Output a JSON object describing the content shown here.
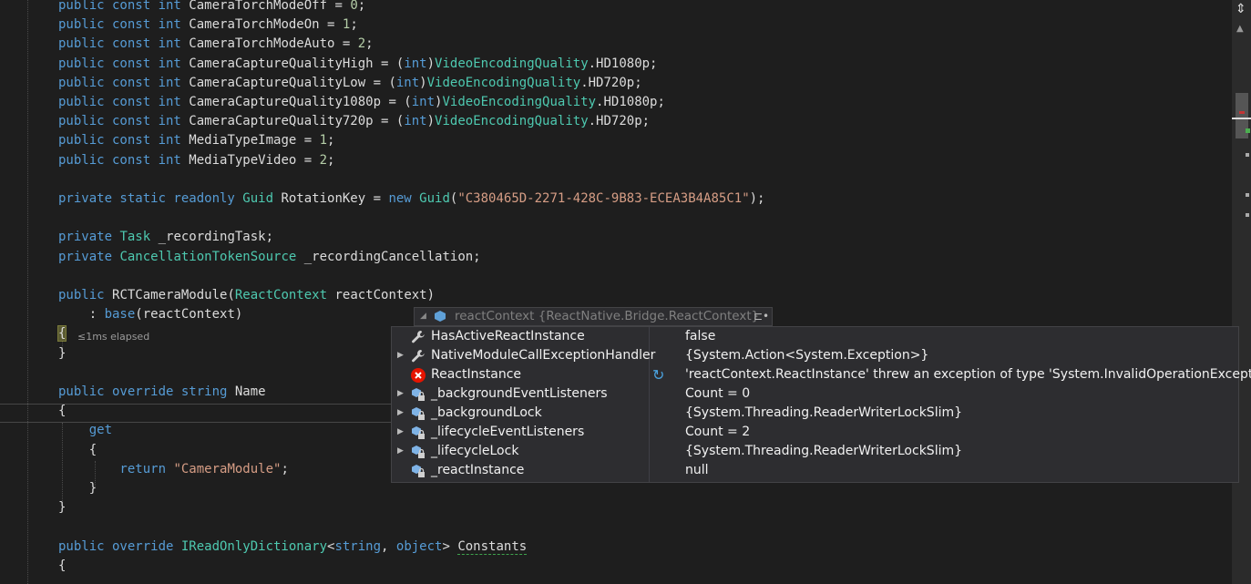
{
  "editor": {
    "lines": [
      [
        [
          "kw",
          "public const int "
        ],
        [
          "",
          "CameraTorchModeOff = "
        ],
        [
          "num",
          "0"
        ],
        [
          "",
          ";"
        ]
      ],
      [
        [
          "kw",
          "public const int "
        ],
        [
          "",
          "CameraTorchModeOn = "
        ],
        [
          "num",
          "1"
        ],
        [
          "",
          ";"
        ]
      ],
      [
        [
          "kw",
          "public const int "
        ],
        [
          "",
          "CameraTorchModeAuto = "
        ],
        [
          "num",
          "2"
        ],
        [
          "",
          ";"
        ]
      ],
      [
        [
          "kw",
          "public const int "
        ],
        [
          "",
          "CameraCaptureQualityHigh = ("
        ],
        [
          "kw",
          "int"
        ],
        [
          "",
          ")"
        ],
        [
          "ty",
          "VideoEncodingQuality"
        ],
        [
          "",
          ".HD1080p;"
        ]
      ],
      [
        [
          "kw",
          "public const int "
        ],
        [
          "",
          "CameraCaptureQualityLow = ("
        ],
        [
          "kw",
          "int"
        ],
        [
          "",
          ")"
        ],
        [
          "ty",
          "VideoEncodingQuality"
        ],
        [
          "",
          ".HD720p;"
        ]
      ],
      [
        [
          "kw",
          "public const int "
        ],
        [
          "",
          "CameraCaptureQuality1080p = ("
        ],
        [
          "kw",
          "int"
        ],
        [
          "",
          ")"
        ],
        [
          "ty",
          "VideoEncodingQuality"
        ],
        [
          "",
          ".HD1080p;"
        ]
      ],
      [
        [
          "kw",
          "public const int "
        ],
        [
          "",
          "CameraCaptureQuality720p = ("
        ],
        [
          "kw",
          "int"
        ],
        [
          "",
          ")"
        ],
        [
          "ty",
          "VideoEncodingQuality"
        ],
        [
          "",
          ".HD720p;"
        ]
      ],
      [
        [
          "kw",
          "public const int "
        ],
        [
          "",
          "MediaTypeImage = "
        ],
        [
          "num",
          "1"
        ],
        [
          "",
          ";"
        ]
      ],
      [
        [
          "kw",
          "public const int "
        ],
        [
          "",
          "MediaTypeVideo = "
        ],
        [
          "num",
          "2"
        ],
        [
          "",
          ";"
        ]
      ],
      [],
      [
        [
          "kw",
          "private static readonly "
        ],
        [
          "ty",
          "Guid"
        ],
        [
          "",
          " RotationKey = "
        ],
        [
          "kw",
          "new "
        ],
        [
          "ty",
          "Guid"
        ],
        [
          "",
          "("
        ],
        [
          "st",
          "\"C380465D-2271-428C-9B83-ECEA3B4A85C1\""
        ],
        [
          "",
          ");"
        ]
      ],
      [],
      [
        [
          "kw",
          "private "
        ],
        [
          "ty",
          "Task"
        ],
        [
          "",
          " _recordingTask;"
        ]
      ],
      [
        [
          "kw",
          "private "
        ],
        [
          "ty",
          "CancellationTokenSource"
        ],
        [
          "",
          " _recordingCancellation;"
        ]
      ],
      [],
      [
        [
          "kw",
          "public "
        ],
        [
          "",
          "RCTCameraModule("
        ],
        [
          "ty",
          "ReactContext"
        ],
        [
          "",
          " reactContext)"
        ]
      ],
      [
        [
          "",
          "    : "
        ],
        [
          "kw",
          "base"
        ],
        [
          "",
          "(reactContext)"
        ]
      ],
      [
        [
          "brace",
          "{"
        ]
      ],
      [
        [
          "",
          "}"
        ]
      ],
      [],
      [
        [
          "kw",
          "public override string "
        ],
        [
          "",
          "Name"
        ]
      ],
      [
        [
          "",
          "{"
        ]
      ],
      [
        [
          "kw",
          "    get"
        ]
      ],
      [
        [
          "",
          "    {"
        ]
      ],
      [
        [
          "kw",
          "        return "
        ],
        [
          "st",
          "\"CameraModule\""
        ],
        [
          "",
          ";"
        ]
      ],
      [
        [
          "",
          "    }"
        ]
      ],
      [
        [
          "",
          "}"
        ]
      ],
      [],
      [
        [
          "kw",
          "public override "
        ],
        [
          "ty",
          "IReadOnlyDictionary"
        ],
        [
          "",
          "<"
        ],
        [
          "kw",
          "string"
        ],
        [
          "",
          ", "
        ],
        [
          "kw",
          "object"
        ],
        [
          "",
          "> "
        ],
        [
          "squig",
          "Constants"
        ]
      ],
      [
        [
          "",
          "{"
        ]
      ]
    ],
    "elapsed": "≤1ms elapsed"
  },
  "datatip": {
    "header_name": "reactContext",
    "header_type": "{ReactNative.Bridge.ReactContext}",
    "rows": [
      {
        "name": "HasActiveReactInstance",
        "value": "false",
        "icon": "wrench-icon",
        "expandable": false,
        "refresh": false
      },
      {
        "name": "NativeModuleCallExceptionHandler",
        "value": "{System.Action<System.Exception>}",
        "icon": "wrench-icon",
        "expandable": true,
        "refresh": false
      },
      {
        "name": "ReactInstance",
        "value": "'reactContext.ReactInstance' threw an exception of type 'System.InvalidOperationException'",
        "icon": "error-icon",
        "expandable": false,
        "refresh": true
      },
      {
        "name": "_backgroundEventListeners",
        "value": "Count = 0",
        "icon": "private-field-icon",
        "expandable": true,
        "refresh": false
      },
      {
        "name": "_backgroundLock",
        "value": "{System.Threading.ReaderWriterLockSlim}",
        "icon": "private-field-icon",
        "expandable": true,
        "refresh": false
      },
      {
        "name": "_lifecycleEventListeners",
        "value": "Count = 2",
        "icon": "private-field-icon",
        "expandable": true,
        "refresh": false
      },
      {
        "name": "_lifecycleLock",
        "value": "{System.Threading.ReaderWriterLockSlim}",
        "icon": "private-field-icon",
        "expandable": true,
        "refresh": false
      },
      {
        "name": "_reactInstance",
        "value": "null",
        "icon": "private-field-icon",
        "expandable": false,
        "refresh": false
      }
    ]
  }
}
